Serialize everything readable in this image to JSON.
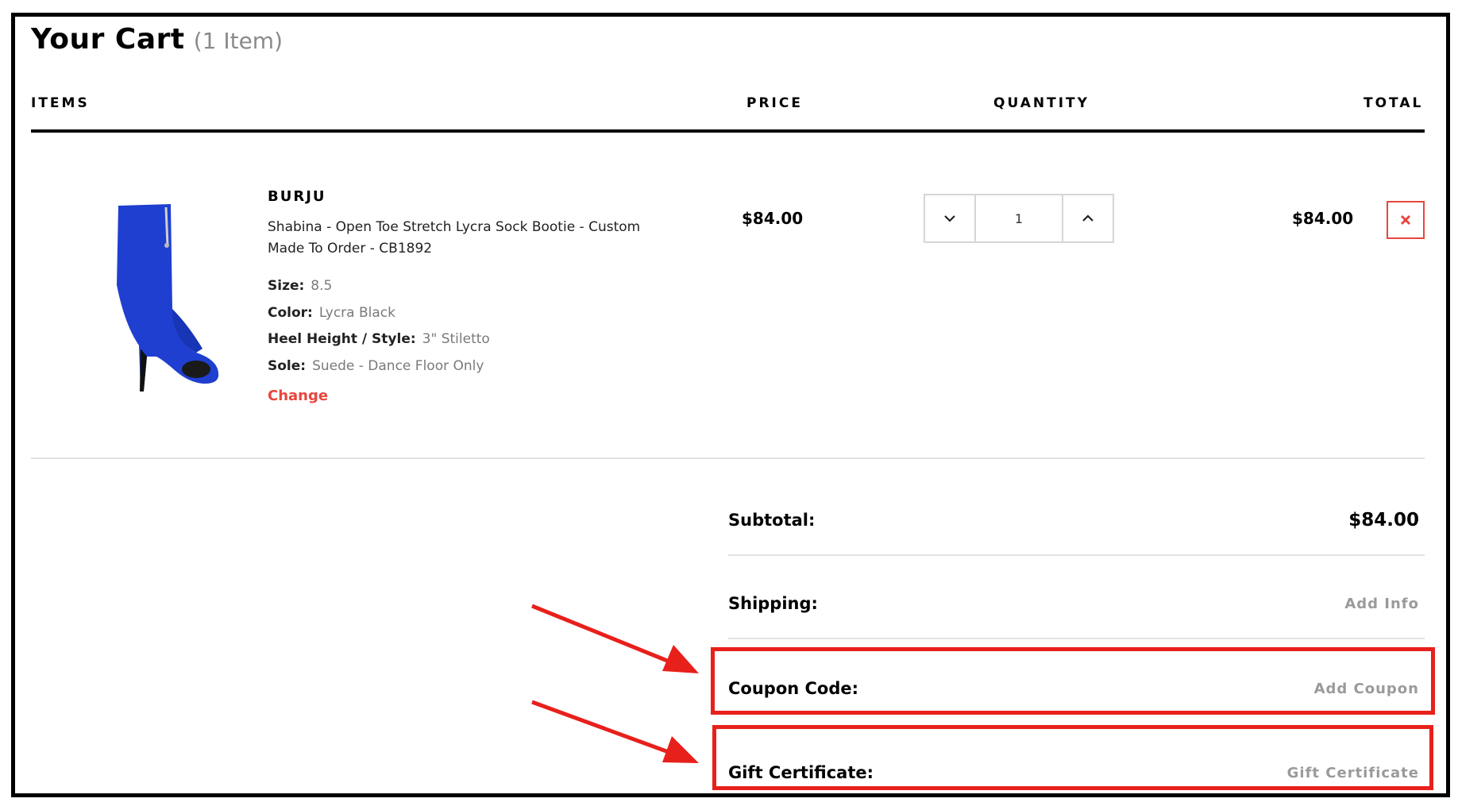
{
  "cart": {
    "title": "Your Cart",
    "item_count": "(1 Item)"
  },
  "columns": {
    "items": "ITEMS",
    "price": "PRICE",
    "quantity": "QUANTITY",
    "total": "TOTAL"
  },
  "line_item": {
    "brand": "BURJU",
    "name": "Shabina - Open Toe Stretch Lycra Sock Bootie - Custom Made To Order - CB1892",
    "options": [
      {
        "key": "Size:",
        "value": "8.5"
      },
      {
        "key": "Color:",
        "value": "Lycra Black"
      },
      {
        "key": "Heel Height / Style:",
        "value": "3\" Stiletto"
      },
      {
        "key": "Sole:",
        "value": "Suede - Dance Floor Only"
      }
    ],
    "change_label": "Change",
    "price": "$84.00",
    "quantity": "1",
    "total": "$84.00",
    "image_icon": "blue-peep-toe-stiletto-bootie"
  },
  "summary": {
    "subtotal_label": "Subtotal:",
    "subtotal_value": "$84.00",
    "shipping_label": "Shipping:",
    "shipping_action": "Add Info",
    "coupon_label": "Coupon Code:",
    "coupon_action": "Add Coupon",
    "gift_label": "Gift Certificate:",
    "gift_action": "Gift Certificate"
  },
  "colors": {
    "accent": "#e8463d",
    "annotation": "#e8201b",
    "product_blue": "#1f3fd0"
  }
}
